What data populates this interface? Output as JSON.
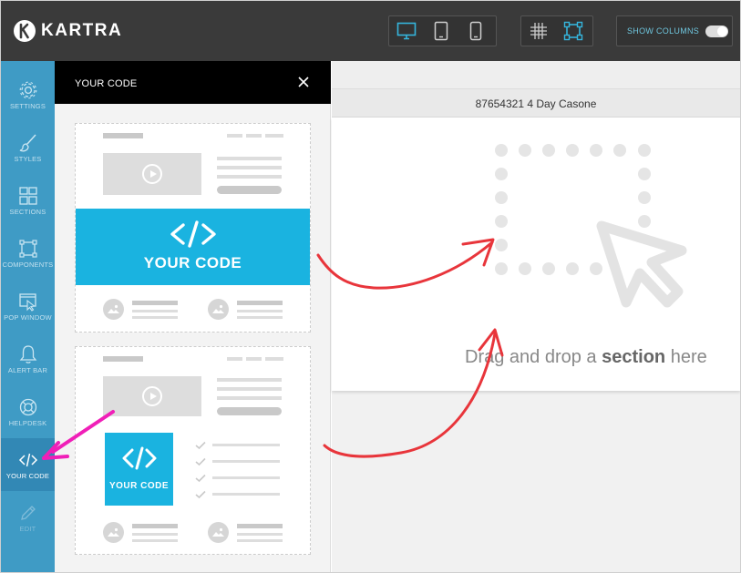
{
  "app": {
    "brand": "KARTRA",
    "show_columns_label": "SHOW COLUMNS",
    "show_columns_on": true,
    "accent_color": "#1ab3e0",
    "nav_color": "#3f9bc5"
  },
  "toolbar": {
    "view_icons": [
      "desktop-icon",
      "tablet-icon",
      "mobile-icon"
    ],
    "layout_icons": [
      "grid-icon",
      "select-frame-icon"
    ]
  },
  "sidebar": {
    "items": [
      {
        "label": "SETTINGS",
        "icon": "gear-icon"
      },
      {
        "label": "STYLES",
        "icon": "brush-icon"
      },
      {
        "label": "SECTIONS",
        "icon": "sections-icon"
      },
      {
        "label": "COMPONENTS",
        "icon": "components-icon"
      },
      {
        "label": "POP WINDOW",
        "icon": "pop-window-icon"
      },
      {
        "label": "ALERT BAR",
        "icon": "bell-icon"
      },
      {
        "label": "HELPDESK",
        "icon": "lifebuoy-icon"
      },
      {
        "label": "YOUR CODE",
        "icon": "code-icon",
        "active": true
      },
      {
        "label": "EDIT",
        "icon": "pencil-icon",
        "disabled": true
      }
    ]
  },
  "panel": {
    "title": "YOUR CODE",
    "cards": [
      {
        "code_label": "YOUR CODE",
        "layout": "full-width band"
      },
      {
        "code_label": "YOUR CODE",
        "layout": "block with checklist"
      }
    ]
  },
  "canvas": {
    "page_name": "87654321 4 Day Casone",
    "drop_text_before": "Drag and drop a ",
    "drop_text_bold": "section",
    "drop_text_after": " here"
  },
  "annotations": {
    "arrow_color": "#e8353b",
    "pointer_color": "#f01fb8"
  }
}
